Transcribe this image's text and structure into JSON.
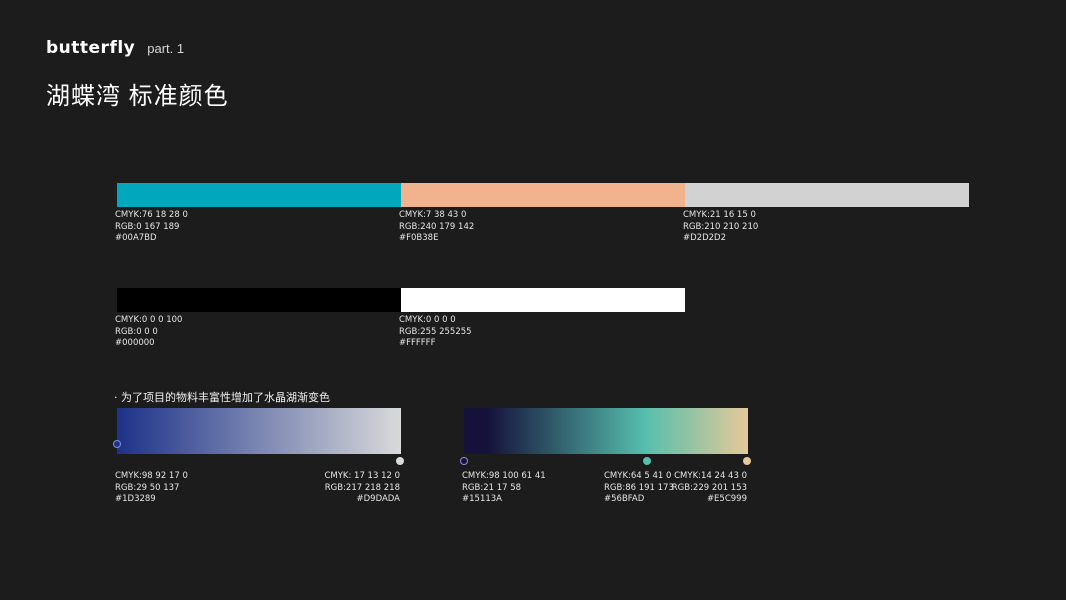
{
  "header": {
    "logo": "butterfly",
    "part": "part. 1",
    "title": "湖蝶湾  标准颜色"
  },
  "solid_colors": [
    {
      "hex_color": "#00A7BD",
      "cmyk": "CMYK:76 18 28 0",
      "rgb": "RGB:0 167 189",
      "hex": "#00A7BD"
    },
    {
      "hex_color": "#F0B38E",
      "cmyk": "CMYK:7 38 43 0",
      "rgb": "RGB:240 179 142",
      "hex": "#F0B38E"
    },
    {
      "hex_color": "#D2D2D2",
      "cmyk": "CMYK:21 16 15 0",
      "rgb": "RGB:210 210 210",
      "hex": "#D2D2D2"
    },
    {
      "hex_color": "#000000",
      "cmyk": "CMYK:0 0 0 100",
      "rgb": "RGB:0 0 0",
      "hex": "#000000"
    },
    {
      "hex_color": "#FFFFFF",
      "cmyk": "CMYK:0 0 0 0",
      "rgb": "RGB:255 255255",
      "hex": "#FFFFFF"
    }
  ],
  "gradient_note": "· 为了项目的物料丰富性增加了水晶湖渐变色",
  "gradients": [
    {
      "stops": [
        {
          "hex_color": "#1D3289",
          "cmyk": "CMYK:98 92 17 0",
          "rgb": "RGB:29 50 137",
          "hex": "#1D3289"
        },
        {
          "hex_color": "#D9DADA",
          "cmyk": "CMYK: 17 13 12 0",
          "rgb": "RGB:217 218 218",
          "hex": "#D9DADA"
        }
      ]
    },
    {
      "stops": [
        {
          "hex_color": "#15113A",
          "cmyk": "CMYK:98 100 61 41",
          "rgb": "RGB:21 17 58",
          "hex": "#15113A"
        },
        {
          "hex_color": "#56BFAD",
          "cmyk": "CMYK:64 5 41 0",
          "rgb": "RGB:86 191 173",
          "hex": "#56BFAD"
        },
        {
          "hex_color": "#E5C999",
          "cmyk": "CMYK:14 24 43 0",
          "rgb": "RGB:229 201 153",
          "hex": "#E5C999"
        }
      ]
    }
  ]
}
